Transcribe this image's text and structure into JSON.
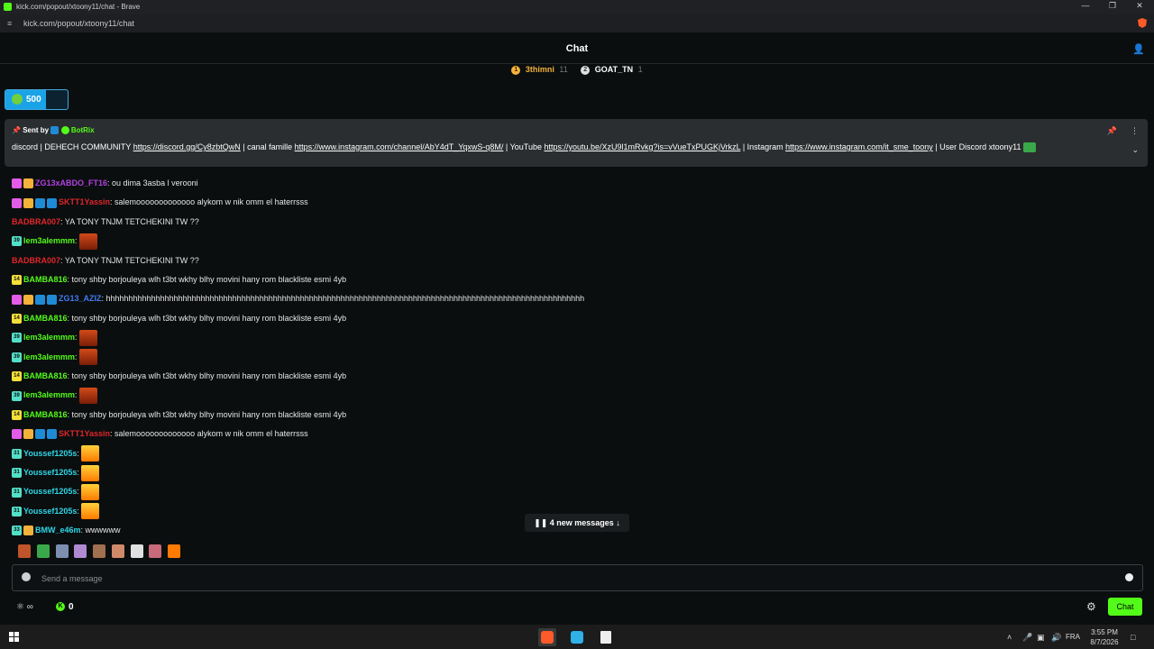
{
  "window": {
    "title": "kick.com/popout/xtoony11/chat - Brave",
    "url": "kick.com/popout/xtoony11/chat"
  },
  "chat": {
    "title": "Chat"
  },
  "leaderboard": [
    {
      "rank": "1",
      "name": "3thimni",
      "count": "11"
    },
    {
      "rank": "2",
      "name": "GOAT_TN",
      "count": "1"
    }
  ],
  "goal": {
    "value": "500",
    "progress": 0.65
  },
  "pinned": {
    "sent_by_label": "Sent by",
    "sender": "BotRix",
    "text_parts": [
      {
        "t": "discord | DEHECH COMMUNITY "
      },
      {
        "t": "https://discord.gg/Cy8zbtQwN",
        "link": true
      },
      {
        "t": " | canal famille "
      },
      {
        "t": "https://www.instagram.com/channel/AbY4dT_YqxwS-q8M/",
        "link": true
      },
      {
        "t": " | YouTube "
      },
      {
        "t": "https://youtu.be/XzU9l1mRvkg?is=vVueTxPUGKjVrkzL",
        "link": true
      },
      {
        "t": " | Instagram "
      },
      {
        "t": "https://www.instagram.com/it_sme_toony",
        "link": true
      },
      {
        "t": " | User Discord xtoony11"
      }
    ]
  },
  "messages": [
    {
      "user": "ZG13xABDO_FT16",
      "color": "#b040e0",
      "badges": [
        "pink",
        "crown"
      ],
      "text": "ou dima 3asba l verooni"
    },
    {
      "user": "SKTT1Yassin",
      "color": "#e0262a",
      "badges": [
        "pink",
        "crown",
        "blue",
        "blue"
      ],
      "text": "salemooooooooooooo alykom w nik omm el haterrsss"
    },
    {
      "user": "BADBRA007",
      "color": "#e0262a",
      "badges": [],
      "text": "YA TONY TNJM TETCHEKINI TW ??"
    },
    {
      "user": "lem3alemmm",
      "color": "#53fc18",
      "badges": [
        "sub"
      ],
      "sub": "39",
      "emote": "fire",
      "text": ""
    },
    {
      "user": "BADBRA007",
      "color": "#e0262a",
      "badges": [],
      "text": "YA TONY TNJM TETCHEKINI TW ??"
    },
    {
      "user": "BAMBA816",
      "color": "#53fc18",
      "badges": [
        "yellow"
      ],
      "sub": "14",
      "text": "tony shby borjouleya wlh t3bt wkhy blhy movini hany rom blackliste esmi 4yb"
    },
    {
      "user": "ZG13_AZIZ",
      "color": "#3f7cf0",
      "badges": [
        "pink",
        "crown",
        "blue",
        "blue"
      ],
      "text": "hhhhhhhhhhhhhhhhhhhhhhhhhhhhhhhhhhhhhhhhhhhhhhhhhhhhhhhhhhhhhhhhhhhhhhhhhhhhhhhhhhhhhhhhhhhhhhhhhhhhhhhhhh"
    },
    {
      "user": "BAMBA816",
      "color": "#53fc18",
      "badges": [
        "yellow"
      ],
      "sub": "14",
      "text": "tony shby borjouleya wlh t3bt wkhy blhy movini hany rom blackliste esmi 4yb"
    },
    {
      "user": "lem3alemmm",
      "color": "#53fc18",
      "badges": [
        "sub"
      ],
      "sub": "39",
      "emote": "fire",
      "text": ""
    },
    {
      "user": "lem3alemmm",
      "color": "#53fc18",
      "badges": [
        "sub"
      ],
      "sub": "39",
      "emote": "fire",
      "text": ""
    },
    {
      "user": "BAMBA816",
      "color": "#53fc18",
      "badges": [
        "yellow"
      ],
      "sub": "14",
      "text": "tony shby borjouleya wlh t3bt wkhy blhy movini hany rom blackliste esmi 4yb"
    },
    {
      "user": "lem3alemmm",
      "color": "#53fc18",
      "badges": [
        "sub"
      ],
      "sub": "39",
      "emote": "fire",
      "text": ""
    },
    {
      "user": "BAMBA816",
      "color": "#53fc18",
      "badges": [
        "yellow"
      ],
      "sub": "14",
      "text": "tony shby borjouleya wlh t3bt wkhy blhy movini hany rom blackliste esmi 4yb"
    },
    {
      "user": "SKTT1Yassin",
      "color": "#e0262a",
      "badges": [
        "pink",
        "crown",
        "blue",
        "blue"
      ],
      "text": "salemooooooooooooo alykom w nik omm el haterrsss"
    },
    {
      "user": "Youssef1205s",
      "color": "#2fd6e6",
      "badges": [
        "sub"
      ],
      "sub": "31",
      "emote": "flame",
      "text": ""
    },
    {
      "user": "Youssef1205s",
      "color": "#2fd6e6",
      "badges": [
        "sub"
      ],
      "sub": "31",
      "emote": "flame",
      "text": ""
    },
    {
      "user": "Youssef1205s",
      "color": "#2fd6e6",
      "badges": [
        "sub"
      ],
      "sub": "31",
      "emote": "flame",
      "text": ""
    },
    {
      "user": "Youssef1205s",
      "color": "#2fd6e6",
      "badges": [
        "sub"
      ],
      "sub": "31",
      "emote": "flame",
      "text": ""
    },
    {
      "user": "BMW_e46m",
      "color": "#2fd6e6",
      "badges": [
        "sub",
        "crown"
      ],
      "sub": "33",
      "text": "wwwwww"
    }
  ],
  "new_messages": {
    "label": "4 new messages"
  },
  "input": {
    "placeholder": "Send a message"
  },
  "bottom": {
    "points": "0",
    "chat_button": "Chat"
  },
  "taskbar": {
    "lang": "FRA",
    "time": "3:55 PM",
    "date": "8/7/2026"
  }
}
